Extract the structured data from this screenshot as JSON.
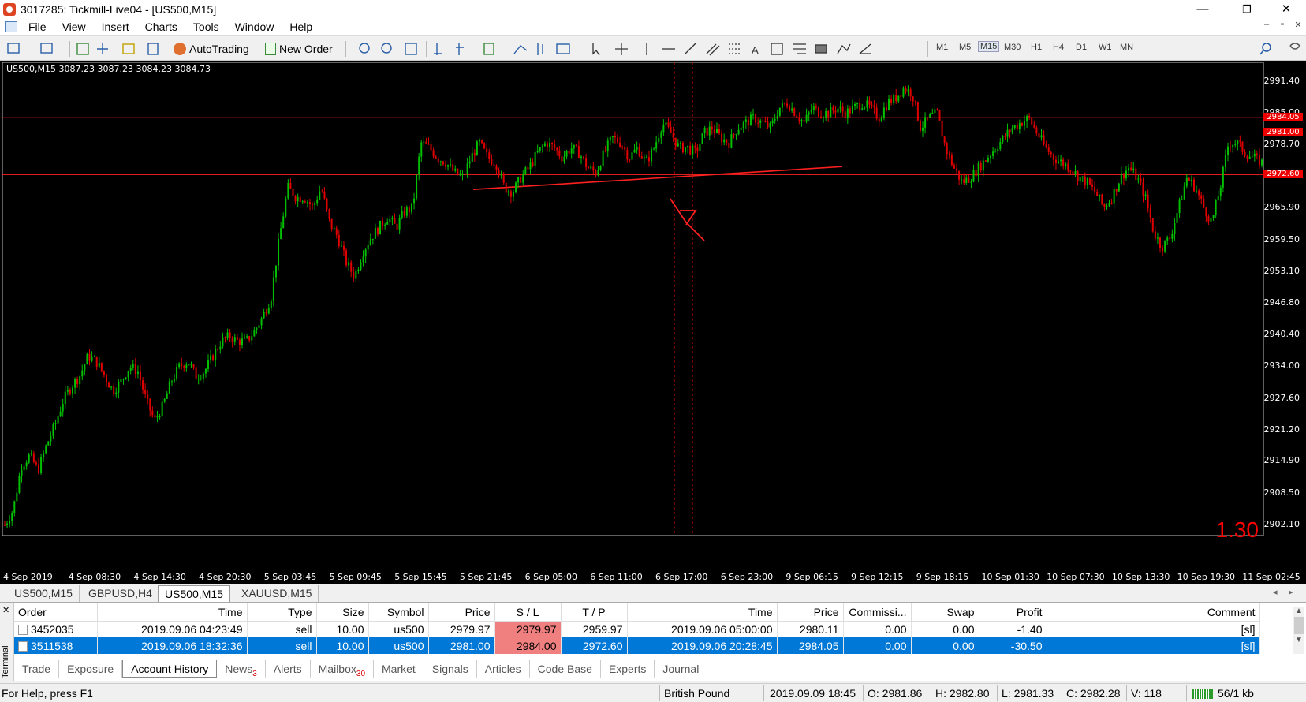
{
  "window": {
    "title": "3017285: Tickmill-Live04 - [US500,M15]",
    "minimize": "—",
    "restore": "❐",
    "close": "✕"
  },
  "menu": [
    "File",
    "View",
    "Insert",
    "Charts",
    "Tools",
    "Window",
    "Help"
  ],
  "toolbar": {
    "autotrading": "AutoTrading",
    "new_order": "New Order",
    "timeframes": [
      "M1",
      "M5",
      "M15",
      "M30",
      "H1",
      "H4",
      "D1",
      "W1",
      "MN"
    ],
    "active_tf": "M15"
  },
  "chart": {
    "header": "US500,M15  3087.23 3087.23 3084.23 3084.73",
    "overlay_value": "1.30",
    "y_ticks": [
      "2991.40",
      "2985.00",
      "2978.70",
      "2972.60",
      "2965.90",
      "2959.50",
      "2953.10",
      "2946.80",
      "2940.40",
      "2934.00",
      "2927.60",
      "2921.20",
      "2914.90",
      "2908.50",
      "2902.10"
    ],
    "x_ticks": [
      "4 Sep 2019",
      "4 Sep 08:30",
      "4 Sep 14:30",
      "4 Sep 20:30",
      "5 Sep 03:45",
      "5 Sep 09:45",
      "5 Sep 15:45",
      "5 Sep 21:45",
      "6 Sep 05:00",
      "6 Sep 11:00",
      "6 Sep 17:00",
      "6 Sep 23:00",
      "9 Sep 06:15",
      "9 Sep 12:15",
      "9 Sep 18:15",
      "10 Sep 01:30",
      "10 Sep 07:30",
      "10 Sep 13:30",
      "10 Sep 19:30",
      "11 Sep 02:45"
    ],
    "price_lines": [
      {
        "label": "2984.05",
        "price": 2984.05
      },
      {
        "label": "2981.00",
        "price": 2981.0
      },
      {
        "label": "2972.60",
        "price": 2972.6
      }
    ],
    "colors": {
      "bull": "#00c000",
      "bear": "#e00000",
      "line": "#ff2020"
    },
    "path": [
      2902,
      2905,
      2914,
      2916,
      2913,
      2918,
      2922,
      2927,
      2930,
      2932,
      2936,
      2935,
      2932,
      2929,
      2931,
      2934,
      2933,
      2927,
      2923,
      2926,
      2931,
      2934,
      2935,
      2932,
      2933,
      2936,
      2939,
      2940,
      2939,
      2939,
      2941,
      2944,
      2948,
      2960,
      2970,
      2968,
      2968,
      2966,
      2970,
      2963,
      2960,
      2955,
      2952,
      2957,
      2960,
      2962,
      2964,
      2962,
      2965,
      2966,
      2979,
      2978,
      2976,
      2975,
      2973,
      2972,
      2976,
      2979,
      2976,
      2975,
      2970,
      2969,
      2972,
      2974,
      2977,
      2979,
      2978,
      2976,
      2978,
      2977,
      2974,
      2973,
      2977,
      2980,
      2979,
      2976,
      2978,
      2975,
      2978,
      2983,
      2981,
      2978,
      2978,
      2977,
      2981,
      2982,
      2980,
      2979,
      2982,
      2983,
      2984,
      2983,
      2982,
      2986,
      2987,
      2985,
      2983,
      2986,
      2985,
      2985,
      2986,
      2985,
      2986,
      2987,
      2986,
      2984,
      2987,
      2988,
      2990,
      2989,
      2982,
      2984,
      2985,
      2978,
      2974,
      2971,
      2972,
      2974,
      2976,
      2978,
      2980,
      2982,
      2983,
      2984,
      2981,
      2978,
      2976,
      2975,
      2974,
      2972,
      2971,
      2969,
      2966,
      2968,
      2972,
      2974,
      2972,
      2968,
      2961,
      2958,
      2960,
      2966,
      2972,
      2970,
      2966,
      2963,
      2970,
      2979,
      2979,
      2977,
      2976,
      2975
    ]
  },
  "chart_tabs": [
    "US500,M15",
    "GBPUSD,H4",
    "US500,M15",
    "XAUUSD,M15"
  ],
  "active_chart_tab": 2,
  "terminal": {
    "columns": [
      "Order",
      "Time",
      "Type",
      "Size",
      "Symbol",
      "Price",
      "S / L",
      "T / P",
      "Time",
      "Price",
      "Commissi...",
      "Swap",
      "Profit",
      "Comment"
    ],
    "rows": [
      [
        "3452035",
        "2019.09.06 04:23:49",
        "sell",
        "10.00",
        "us500",
        "2979.97",
        "2979.97",
        "2959.97",
        "2019.09.06 05:00:00",
        "2980.11",
        "0.00",
        "0.00",
        "-1.40",
        "[sl]"
      ],
      [
        "3511538",
        "2019.09.06 18:32:36",
        "sell",
        "10.00",
        "us500",
        "2981.00",
        "2984.00",
        "2972.60",
        "2019.09.06 20:28:45",
        "2984.05",
        "0.00",
        "0.00",
        "-30.50",
        "[sl]"
      ]
    ],
    "selected_row": 1,
    "side_label": "Terminal",
    "tabs": [
      {
        "label": "Trade",
        "badge": ""
      },
      {
        "label": "Exposure",
        "badge": ""
      },
      {
        "label": "Account History",
        "badge": ""
      },
      {
        "label": "News",
        "badge": "3"
      },
      {
        "label": "Alerts",
        "badge": ""
      },
      {
        "label": "Mailbox",
        "badge": "30"
      },
      {
        "label": "Market",
        "badge": ""
      },
      {
        "label": "Signals",
        "badge": ""
      },
      {
        "label": "Articles",
        "badge": ""
      },
      {
        "label": "Code Base",
        "badge": ""
      },
      {
        "label": "Experts",
        "badge": ""
      },
      {
        "label": "Journal",
        "badge": ""
      }
    ],
    "active_tab": "Account History"
  },
  "status": {
    "help": "For Help, press F1",
    "profile": "British Pound",
    "datetime": "2019.09.09 18:45",
    "open": "O: 2981.86",
    "high": "H: 2982.80",
    "low": "L: 2981.33",
    "close": "C: 2982.28",
    "volume": "V: 118",
    "traffic": "56/1 kb"
  }
}
